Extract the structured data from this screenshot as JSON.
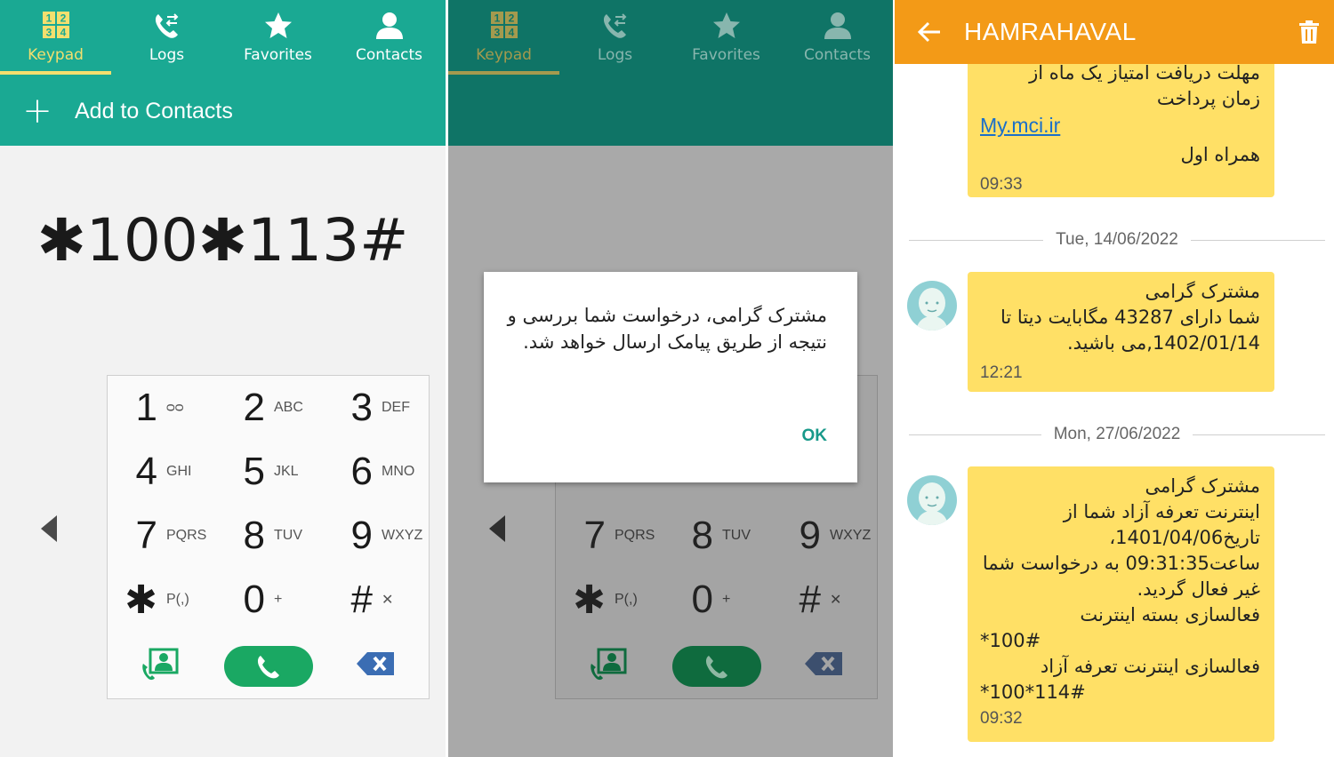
{
  "tabs": [
    {
      "label": "Keypad",
      "icon": "keypad-icon",
      "active": true
    },
    {
      "label": "Logs",
      "icon": "logs-icon",
      "active": false
    },
    {
      "label": "Favorites",
      "icon": "star-icon",
      "active": false
    },
    {
      "label": "Contacts",
      "icon": "contact-icon",
      "active": false
    }
  ],
  "keypad_icon_digits": [
    "1",
    "2",
    "3",
    "4"
  ],
  "add_to_contacts": "Add to Contacts",
  "dialed_number": "✱100✱113#",
  "keys": [
    {
      "digit": "1",
      "letters": "ᴑᴑ"
    },
    {
      "digit": "2",
      "letters": "ABC"
    },
    {
      "digit": "3",
      "letters": "DEF"
    },
    {
      "digit": "4",
      "letters": "GHI"
    },
    {
      "digit": "5",
      "letters": "JKL"
    },
    {
      "digit": "6",
      "letters": "MNO"
    },
    {
      "digit": "7",
      "letters": "PQRS"
    },
    {
      "digit": "8",
      "letters": "TUV"
    },
    {
      "digit": "9",
      "letters": "WXYZ"
    },
    {
      "digit": "✱",
      "letters": "P(,)"
    },
    {
      "digit": "0",
      "letters": "+"
    },
    {
      "digit": "#",
      "letters": "✕"
    }
  ],
  "dialog": {
    "text": "مشترک گرامی، درخواست شما بررسی و نتیجه از طریق پیامک ارسال خواهد شد.",
    "ok": "OK"
  },
  "messages": {
    "title": "HAMRAHAVAL",
    "colors": {
      "header": "#f39a17",
      "bubble": "#ffe066",
      "link": "#1a6fc9"
    },
    "bubble1": {
      "lines": [
        "مهلت دریافت امتیاز یک ماه از",
        "زمان پرداخت"
      ],
      "link": "My.mci.ir",
      "signature": "همراه اول",
      "time": "09:33"
    },
    "date1": "Tue, 14/06/2022",
    "bubble2": {
      "lines": [
        "مشترک گرامی",
        "شما دارای 43287 مگابایت دیتا تا",
        "1402/01/14,می باشید."
      ],
      "time": "12:21"
    },
    "date2": "Mon, 27/06/2022",
    "bubble3": {
      "lines": [
        "مشترک گرامی",
        "اینترنت تعرفه آزاد شما از",
        "تاریخ1401/04/06،",
        "ساعت09:31:35 به درخواست شما",
        "غیر فعال گردید.",
        "فعالسازی بسته اینترنت"
      ],
      "code1": "*100#",
      "line_mid": "فعالسازی اینترنت تعرفه آزاد",
      "code2": "*100*114#",
      "time": "09:32"
    }
  }
}
